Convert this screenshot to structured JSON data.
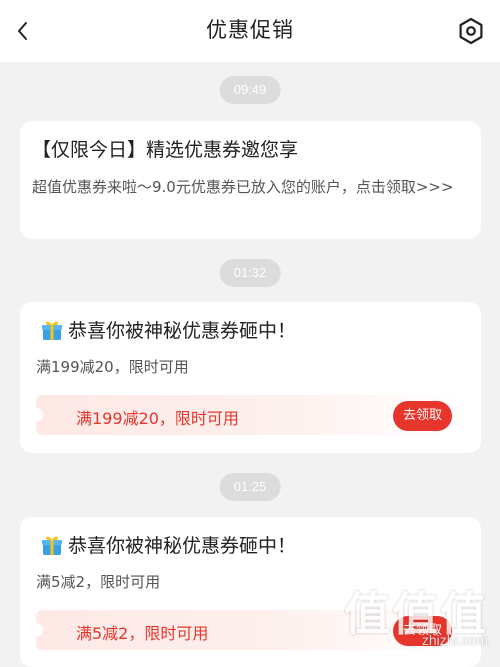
{
  "header": {
    "title": "优惠促销",
    "back_icon": "chevron-left-icon",
    "settings_icon": "hexagon-settings-icon"
  },
  "messages": [
    {
      "time": "09:49",
      "title": "【仅限今日】精选优惠券邀您享",
      "body": "超值优惠券来啦～9.0元优惠券已放入您的账户，点击领取>>>"
    },
    {
      "time": "01:32",
      "title": "恭喜你被神秘优惠券砸中！",
      "desc": "满199减20，限时可用",
      "coupon_text": "满199减20，限时可用",
      "claim_label": "去领取"
    },
    {
      "time": "01:25",
      "title": "恭喜你被神秘优惠券砸中！",
      "desc": "满5减2，限时可用",
      "coupon_text": "满5减2，限时可用",
      "claim_label": "去领取"
    }
  ],
  "watermark": {
    "chars": "值值值",
    "url": "zhizhi.com"
  },
  "colors": {
    "accent": "#e8352b",
    "background": "#f2f2f2",
    "time_pill": "#dcdcdc",
    "coupon_strip": "#fde9e6"
  }
}
